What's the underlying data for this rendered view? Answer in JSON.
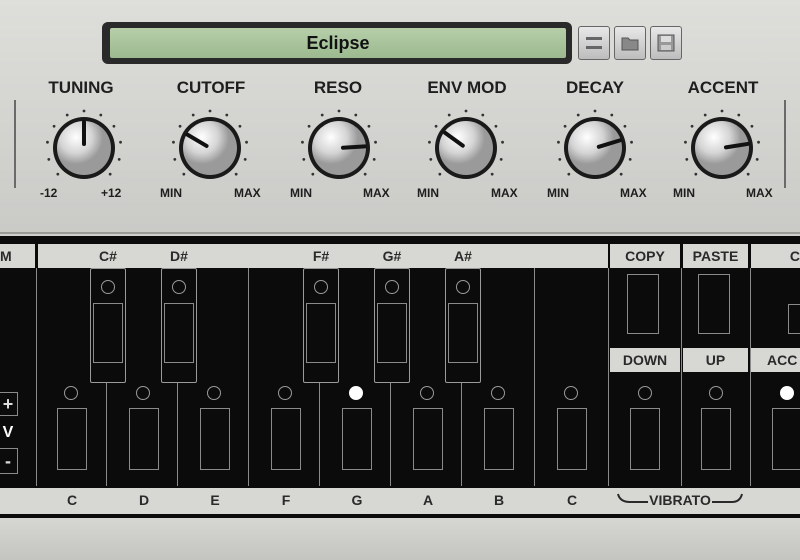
{
  "preset": {
    "name": "Eclipse"
  },
  "preset_buttons": [
    {
      "name": "arrows-icon",
      "glyph": "⬍"
    },
    {
      "name": "folder-icon",
      "glyph": "▭"
    },
    {
      "name": "save-icon",
      "glyph": "▣"
    }
  ],
  "knobs": [
    {
      "id": "tuning",
      "label": "TUNING",
      "min_label": "-12",
      "max_label": "+12",
      "value": 0.5
    },
    {
      "id": "cutoff",
      "label": "CUTOFF",
      "min_label": "MIN",
      "max_label": "MAX",
      "value": 0.28
    },
    {
      "id": "reso",
      "label": "RESO",
      "min_label": "MIN",
      "max_label": "MAX",
      "value": 0.82
    },
    {
      "id": "envmod",
      "label": "ENV MOD",
      "min_label": "MIN",
      "max_label": "MAX",
      "value": 0.3
    },
    {
      "id": "decay",
      "label": "DECAY",
      "min_label": "MIN",
      "max_label": "MAX",
      "value": 0.77
    },
    {
      "id": "accent",
      "label": "ACCENT",
      "min_label": "MIN",
      "max_label": "MAX",
      "value": 0.8
    }
  ],
  "left_strip_label": "M",
  "sharp_labels": [
    "C#",
    "D#",
    "F#",
    "G#",
    "A#"
  ],
  "natural_labels": [
    "C",
    "D",
    "E",
    "F",
    "G",
    "A",
    "B",
    "C"
  ],
  "natural_on": [
    false,
    false,
    false,
    false,
    true,
    false,
    false,
    false
  ],
  "octave": {
    "plus": "+",
    "label": "V",
    "minus": "-"
  },
  "right_top_labels": [
    "COPY",
    "PASTE",
    "C"
  ],
  "right_mid_labels": [
    "DOWN",
    "UP",
    "ACC"
  ],
  "right_mid_on": [
    false,
    false,
    true
  ],
  "vibrato_label": "VIBRATO"
}
